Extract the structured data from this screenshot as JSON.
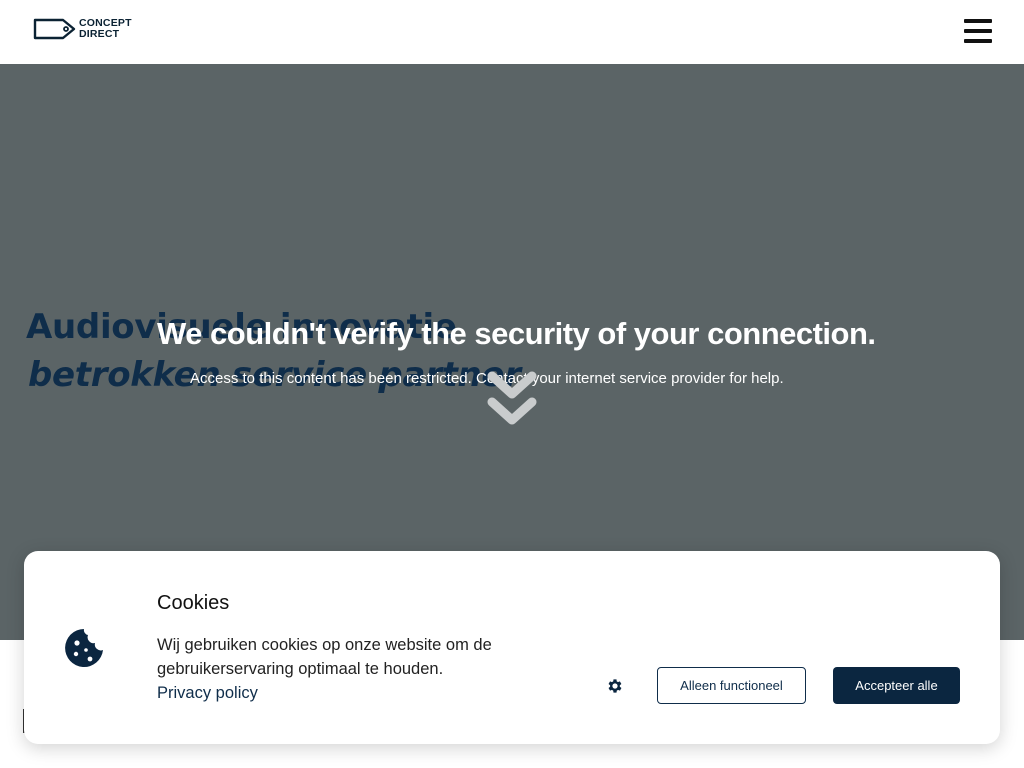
{
  "header": {
    "logo_line1": "CONCEPT",
    "logo_line2": "DIRECT",
    "menu_icon": "hamburger-menu-icon"
  },
  "hero": {
    "title": "Audiovisuele innovatie",
    "subtitle": "betrokken service partner",
    "scroll_icon": "double-chevron-down-icon",
    "background_color": "#5b6466"
  },
  "error_overlay": {
    "title": "We couldn't verify the security of your connection.",
    "text": "Access to this content has been restricted. Contact your internet service provider for help."
  },
  "cookie_banner": {
    "title": "Cookies",
    "text": "Wij gebruiken cookies op onze website om de gebruikerservaring optimaal te houden.",
    "privacy_link": "Privacy policy",
    "settings_icon": "gear-icon",
    "cookie_icon": "cookie-icon",
    "functional_button": "Alleen functioneel",
    "accept_button": "Accepteer alle"
  },
  "colors": {
    "brand_dark": "#0b2640",
    "text_navy": "#0f2d4a",
    "overlay_text": "#ffffff"
  }
}
